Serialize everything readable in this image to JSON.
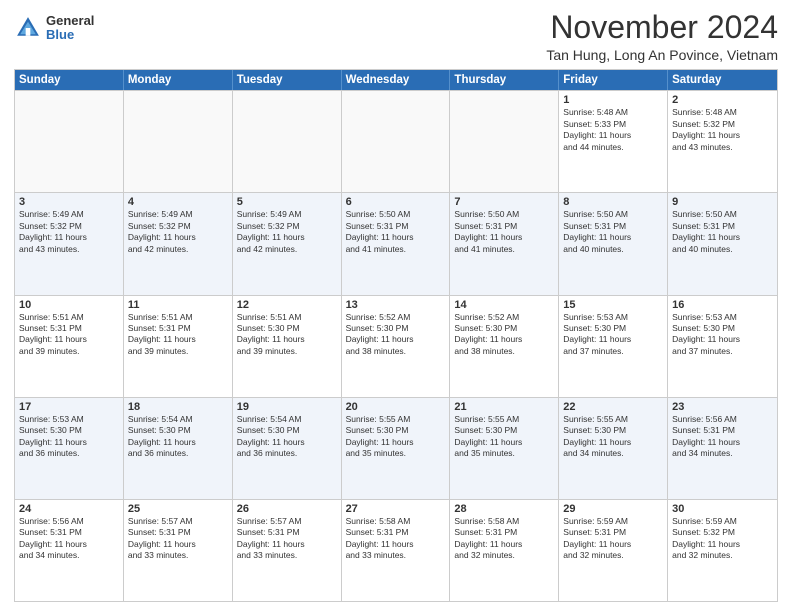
{
  "logo": {
    "general": "General",
    "blue": "Blue"
  },
  "header": {
    "month": "November 2024",
    "location": "Tan Hung, Long An Povince, Vietnam"
  },
  "days": [
    "Sunday",
    "Monday",
    "Tuesday",
    "Wednesday",
    "Thursday",
    "Friday",
    "Saturday"
  ],
  "weeks": [
    [
      {
        "day": "",
        "text": ""
      },
      {
        "day": "",
        "text": ""
      },
      {
        "day": "",
        "text": ""
      },
      {
        "day": "",
        "text": ""
      },
      {
        "day": "",
        "text": ""
      },
      {
        "day": "1",
        "text": "Sunrise: 5:48 AM\nSunset: 5:33 PM\nDaylight: 11 hours\nand 44 minutes."
      },
      {
        "day": "2",
        "text": "Sunrise: 5:48 AM\nSunset: 5:32 PM\nDaylight: 11 hours\nand 43 minutes."
      }
    ],
    [
      {
        "day": "3",
        "text": "Sunrise: 5:49 AM\nSunset: 5:32 PM\nDaylight: 11 hours\nand 43 minutes."
      },
      {
        "day": "4",
        "text": "Sunrise: 5:49 AM\nSunset: 5:32 PM\nDaylight: 11 hours\nand 42 minutes."
      },
      {
        "day": "5",
        "text": "Sunrise: 5:49 AM\nSunset: 5:32 PM\nDaylight: 11 hours\nand 42 minutes."
      },
      {
        "day": "6",
        "text": "Sunrise: 5:50 AM\nSunset: 5:31 PM\nDaylight: 11 hours\nand 41 minutes."
      },
      {
        "day": "7",
        "text": "Sunrise: 5:50 AM\nSunset: 5:31 PM\nDaylight: 11 hours\nand 41 minutes."
      },
      {
        "day": "8",
        "text": "Sunrise: 5:50 AM\nSunset: 5:31 PM\nDaylight: 11 hours\nand 40 minutes."
      },
      {
        "day": "9",
        "text": "Sunrise: 5:50 AM\nSunset: 5:31 PM\nDaylight: 11 hours\nand 40 minutes."
      }
    ],
    [
      {
        "day": "10",
        "text": "Sunrise: 5:51 AM\nSunset: 5:31 PM\nDaylight: 11 hours\nand 39 minutes."
      },
      {
        "day": "11",
        "text": "Sunrise: 5:51 AM\nSunset: 5:31 PM\nDaylight: 11 hours\nand 39 minutes."
      },
      {
        "day": "12",
        "text": "Sunrise: 5:51 AM\nSunset: 5:30 PM\nDaylight: 11 hours\nand 39 minutes."
      },
      {
        "day": "13",
        "text": "Sunrise: 5:52 AM\nSunset: 5:30 PM\nDaylight: 11 hours\nand 38 minutes."
      },
      {
        "day": "14",
        "text": "Sunrise: 5:52 AM\nSunset: 5:30 PM\nDaylight: 11 hours\nand 38 minutes."
      },
      {
        "day": "15",
        "text": "Sunrise: 5:53 AM\nSunset: 5:30 PM\nDaylight: 11 hours\nand 37 minutes."
      },
      {
        "day": "16",
        "text": "Sunrise: 5:53 AM\nSunset: 5:30 PM\nDaylight: 11 hours\nand 37 minutes."
      }
    ],
    [
      {
        "day": "17",
        "text": "Sunrise: 5:53 AM\nSunset: 5:30 PM\nDaylight: 11 hours\nand 36 minutes."
      },
      {
        "day": "18",
        "text": "Sunrise: 5:54 AM\nSunset: 5:30 PM\nDaylight: 11 hours\nand 36 minutes."
      },
      {
        "day": "19",
        "text": "Sunrise: 5:54 AM\nSunset: 5:30 PM\nDaylight: 11 hours\nand 36 minutes."
      },
      {
        "day": "20",
        "text": "Sunrise: 5:55 AM\nSunset: 5:30 PM\nDaylight: 11 hours\nand 35 minutes."
      },
      {
        "day": "21",
        "text": "Sunrise: 5:55 AM\nSunset: 5:30 PM\nDaylight: 11 hours\nand 35 minutes."
      },
      {
        "day": "22",
        "text": "Sunrise: 5:55 AM\nSunset: 5:30 PM\nDaylight: 11 hours\nand 34 minutes."
      },
      {
        "day": "23",
        "text": "Sunrise: 5:56 AM\nSunset: 5:31 PM\nDaylight: 11 hours\nand 34 minutes."
      }
    ],
    [
      {
        "day": "24",
        "text": "Sunrise: 5:56 AM\nSunset: 5:31 PM\nDaylight: 11 hours\nand 34 minutes."
      },
      {
        "day": "25",
        "text": "Sunrise: 5:57 AM\nSunset: 5:31 PM\nDaylight: 11 hours\nand 33 minutes."
      },
      {
        "day": "26",
        "text": "Sunrise: 5:57 AM\nSunset: 5:31 PM\nDaylight: 11 hours\nand 33 minutes."
      },
      {
        "day": "27",
        "text": "Sunrise: 5:58 AM\nSunset: 5:31 PM\nDaylight: 11 hours\nand 33 minutes."
      },
      {
        "day": "28",
        "text": "Sunrise: 5:58 AM\nSunset: 5:31 PM\nDaylight: 11 hours\nand 32 minutes."
      },
      {
        "day": "29",
        "text": "Sunrise: 5:59 AM\nSunset: 5:31 PM\nDaylight: 11 hours\nand 32 minutes."
      },
      {
        "day": "30",
        "text": "Sunrise: 5:59 AM\nSunset: 5:32 PM\nDaylight: 11 hours\nand 32 minutes."
      }
    ]
  ]
}
